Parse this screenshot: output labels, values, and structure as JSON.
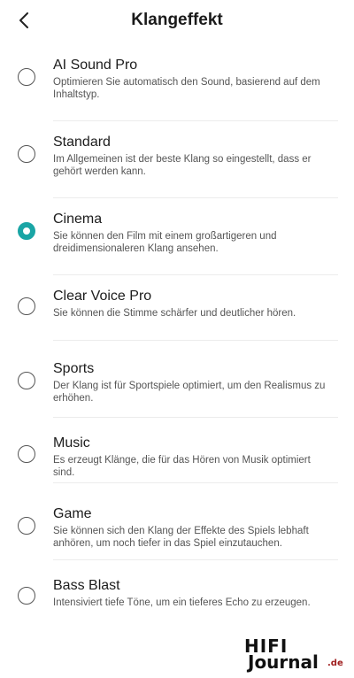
{
  "header": {
    "title": "Klangeffekt",
    "back_icon": "chevron-left-icon"
  },
  "accent_color": "#1aa5a5",
  "items": [
    {
      "name": "AI Sound Pro",
      "desc": "Optimieren Sie automatisch den Sound, basierend auf dem Inhaltstyp.",
      "selected": false
    },
    {
      "name": "Standard",
      "desc": "Im Allgemeinen ist der beste Klang so eingestellt, dass er gehört werden kann.",
      "selected": false
    },
    {
      "name": "Cinema",
      "desc": "Sie können den Film mit einem großartigeren und dreidimensionaleren Klang ansehen.",
      "selected": true
    },
    {
      "name": "Clear Voice Pro",
      "desc": "Sie können die Stimme schärfer und deutlicher hören.",
      "selected": false
    },
    {
      "name": "Sports",
      "desc": "Der Klang ist für Sportspiele optimiert, um den Realismus zu erhöhen.",
      "selected": false
    },
    {
      "name": "Music",
      "desc": "Es erzeugt Klänge, die für das Hören von Musik optimiert sind.",
      "selected": false
    },
    {
      "name": "Game",
      "desc": "Sie können sich den Klang der Effekte des Spiels lebhaft anhören, um noch tiefer in das Spiel einzutauchen.",
      "selected": false
    },
    {
      "name": "Bass Blast",
      "desc": "Intensiviert tiefe Töne, um ein tieferes Echo zu erzeugen.",
      "selected": false
    }
  ],
  "watermark": {
    "line1": "HIFI",
    "line2": "Journal",
    "suffix": ".de"
  }
}
